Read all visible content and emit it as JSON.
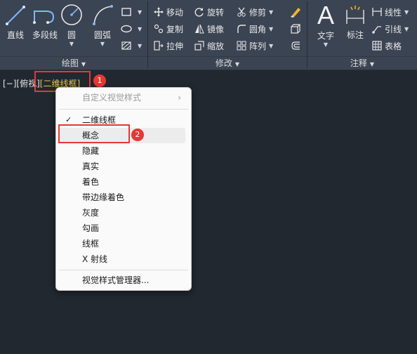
{
  "ribbon": {
    "draw": {
      "title": "绘图",
      "line": "直线",
      "polyline": "多段线",
      "circle": "圆",
      "arc": "圆弧"
    },
    "modify": {
      "title": "修改",
      "move": "移动",
      "rotate": "旋转",
      "trim": "修剪",
      "copy": "复制",
      "mirror": "镜像",
      "fillet": "圆角",
      "stretch": "拉伸",
      "scale": "缩放",
      "array": "阵列"
    },
    "annotation": {
      "title": "注释",
      "text": "文字",
      "dimension": "标注",
      "linear": "线性",
      "leader": "引线",
      "table": "表格"
    }
  },
  "viewport": {
    "prefix": "[−][俯视]",
    "visual_style": "[二维线框]"
  },
  "callouts": [
    "1",
    "2"
  ],
  "menu": {
    "header": "自定义视觉样式",
    "items": [
      "二维线框",
      "概念",
      "隐藏",
      "真实",
      "着色",
      "带边缘着色",
      "灰度",
      "勾画",
      "线框",
      "X 射线"
    ],
    "checked": "二维线框",
    "manager": "视觉样式管理器..."
  },
  "colors": {
    "background": "#212830",
    "ribbon": "#3b4453",
    "active_style": "#e8c54a",
    "highlight": "#e53935"
  }
}
